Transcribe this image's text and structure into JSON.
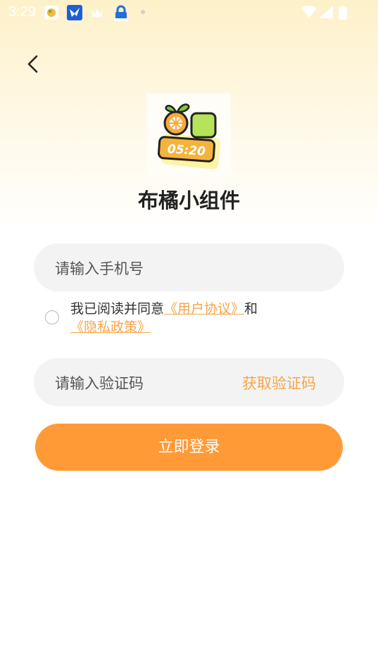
{
  "status_bar": {
    "time": "3:29"
  },
  "header": {
    "back_label": "back"
  },
  "logo": {
    "clock_text": "05:20"
  },
  "app_name": "布橘小组件",
  "phone_input": {
    "placeholder": "请输入手机号"
  },
  "agreement": {
    "prefix": "我已阅读并同意",
    "user_agreement": "《用户协议》",
    "and": "和",
    "privacy_policy": "《隐私政策》"
  },
  "code_input": {
    "placeholder": "请输入验证码",
    "get_code_label": "获取验证码"
  },
  "login_button": {
    "label": "立即登录"
  },
  "colors": {
    "accent": "#ff9a36",
    "link": "#f6a54a",
    "field_bg": "#f3f3f3"
  }
}
